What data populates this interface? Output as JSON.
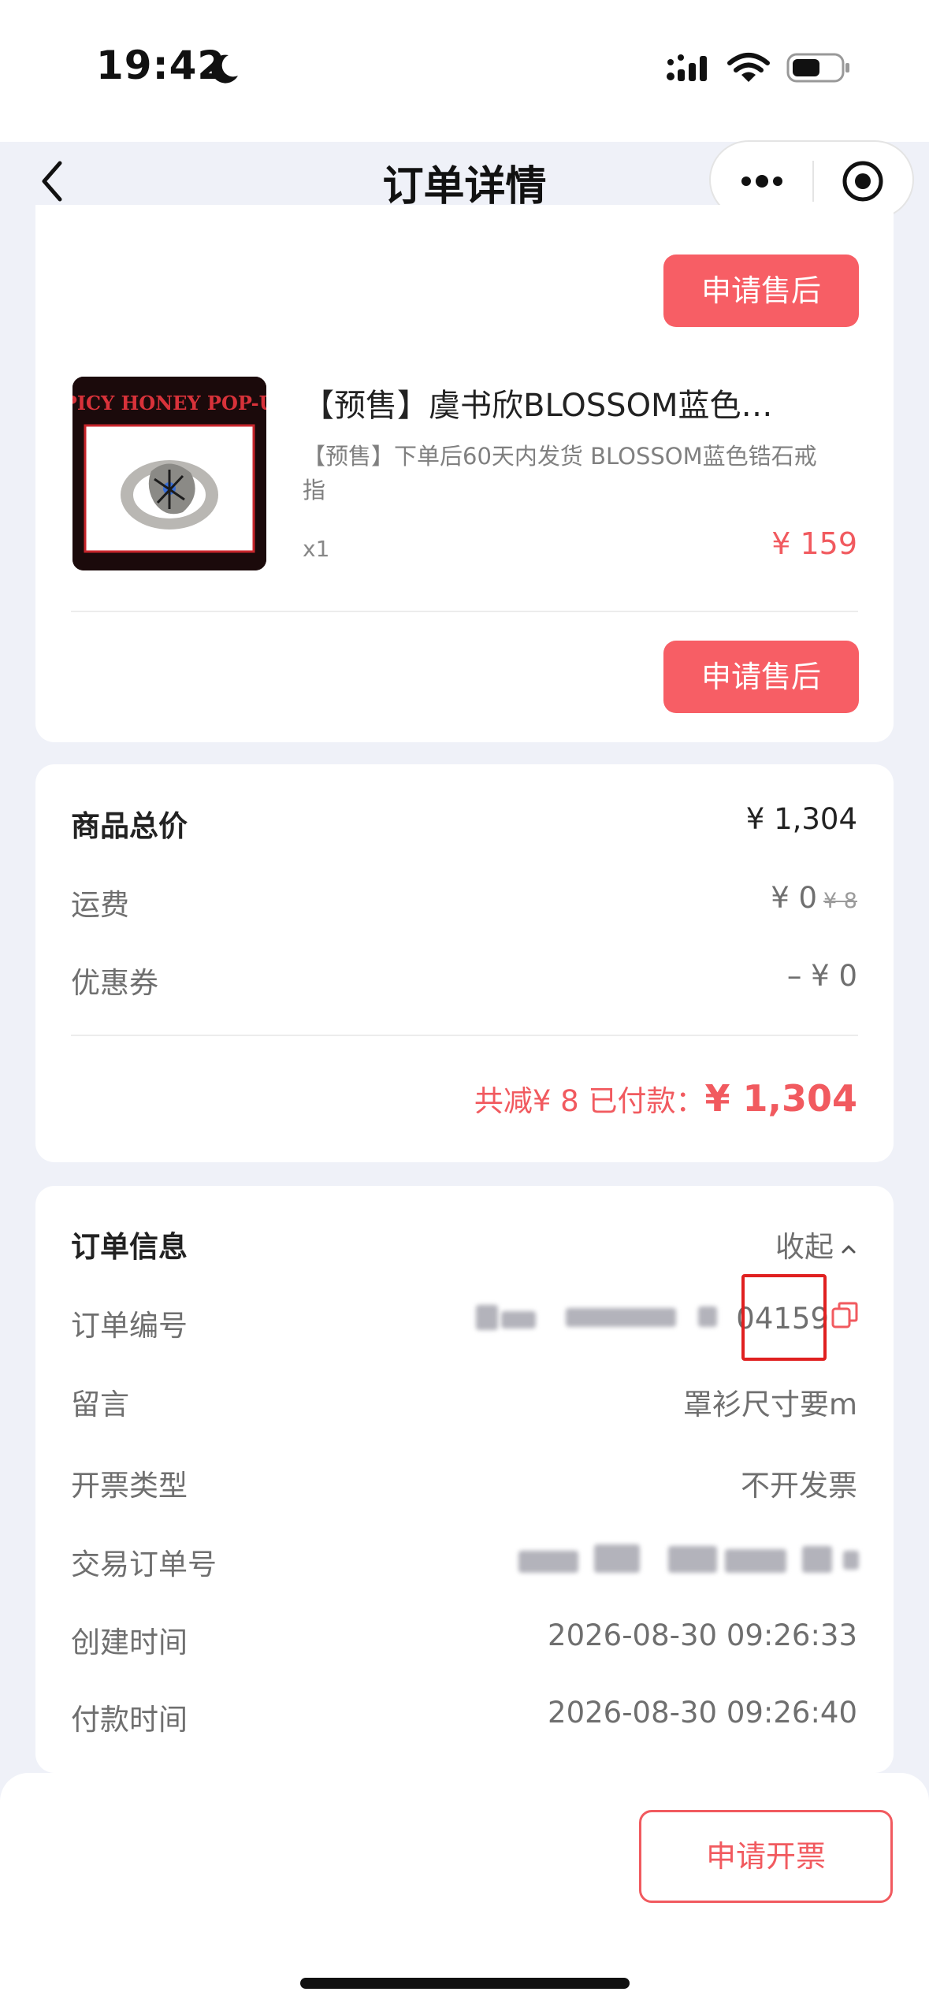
{
  "status_bar": {
    "time": "19:42"
  },
  "nav": {
    "title": "订单详情"
  },
  "product": {
    "name": "【预售】虞书欣BLOSSOM蓝色…",
    "spec": "【预售】下单后60天内发货 BLOSSOM蓝色锆石戒指",
    "qty": "x1",
    "price": "¥ 159",
    "thumb_title": "SPICY HONEY POP-UP"
  },
  "after_sale_label": "申请售后",
  "price_summary": {
    "subtotal_label": "商品总价",
    "subtotal_value": "¥ 1,304",
    "shipping_label": "运费",
    "shipping_value": "¥ 0",
    "shipping_original": "¥ 8",
    "coupon_label": "优惠券",
    "coupon_value": "– ¥ 0",
    "total_prefix": "共减¥ 8  已付款：",
    "total_value": "¥ 1,304"
  },
  "order_info": {
    "title": "订单信息",
    "collapse_label": "收起",
    "order_no_label": "订单编号",
    "order_no_visible": "04159",
    "message_label": "留言",
    "message_value": "罩衫尺寸要m",
    "invoice_type_label": "开票类型",
    "invoice_type_value": "不开发票",
    "trade_no_label": "交易订单号",
    "created_label": "创建时间",
    "created_value": "2026-08-30 09:26:33",
    "paid_label": "付款时间",
    "paid_value": "2026-08-30 09:26:40"
  },
  "bottom": {
    "invoice_button": "申请开票"
  },
  "colors": {
    "accent": "#f15a5f",
    "button_fill": "#f75e65",
    "page_bg": "#eff1f8"
  }
}
